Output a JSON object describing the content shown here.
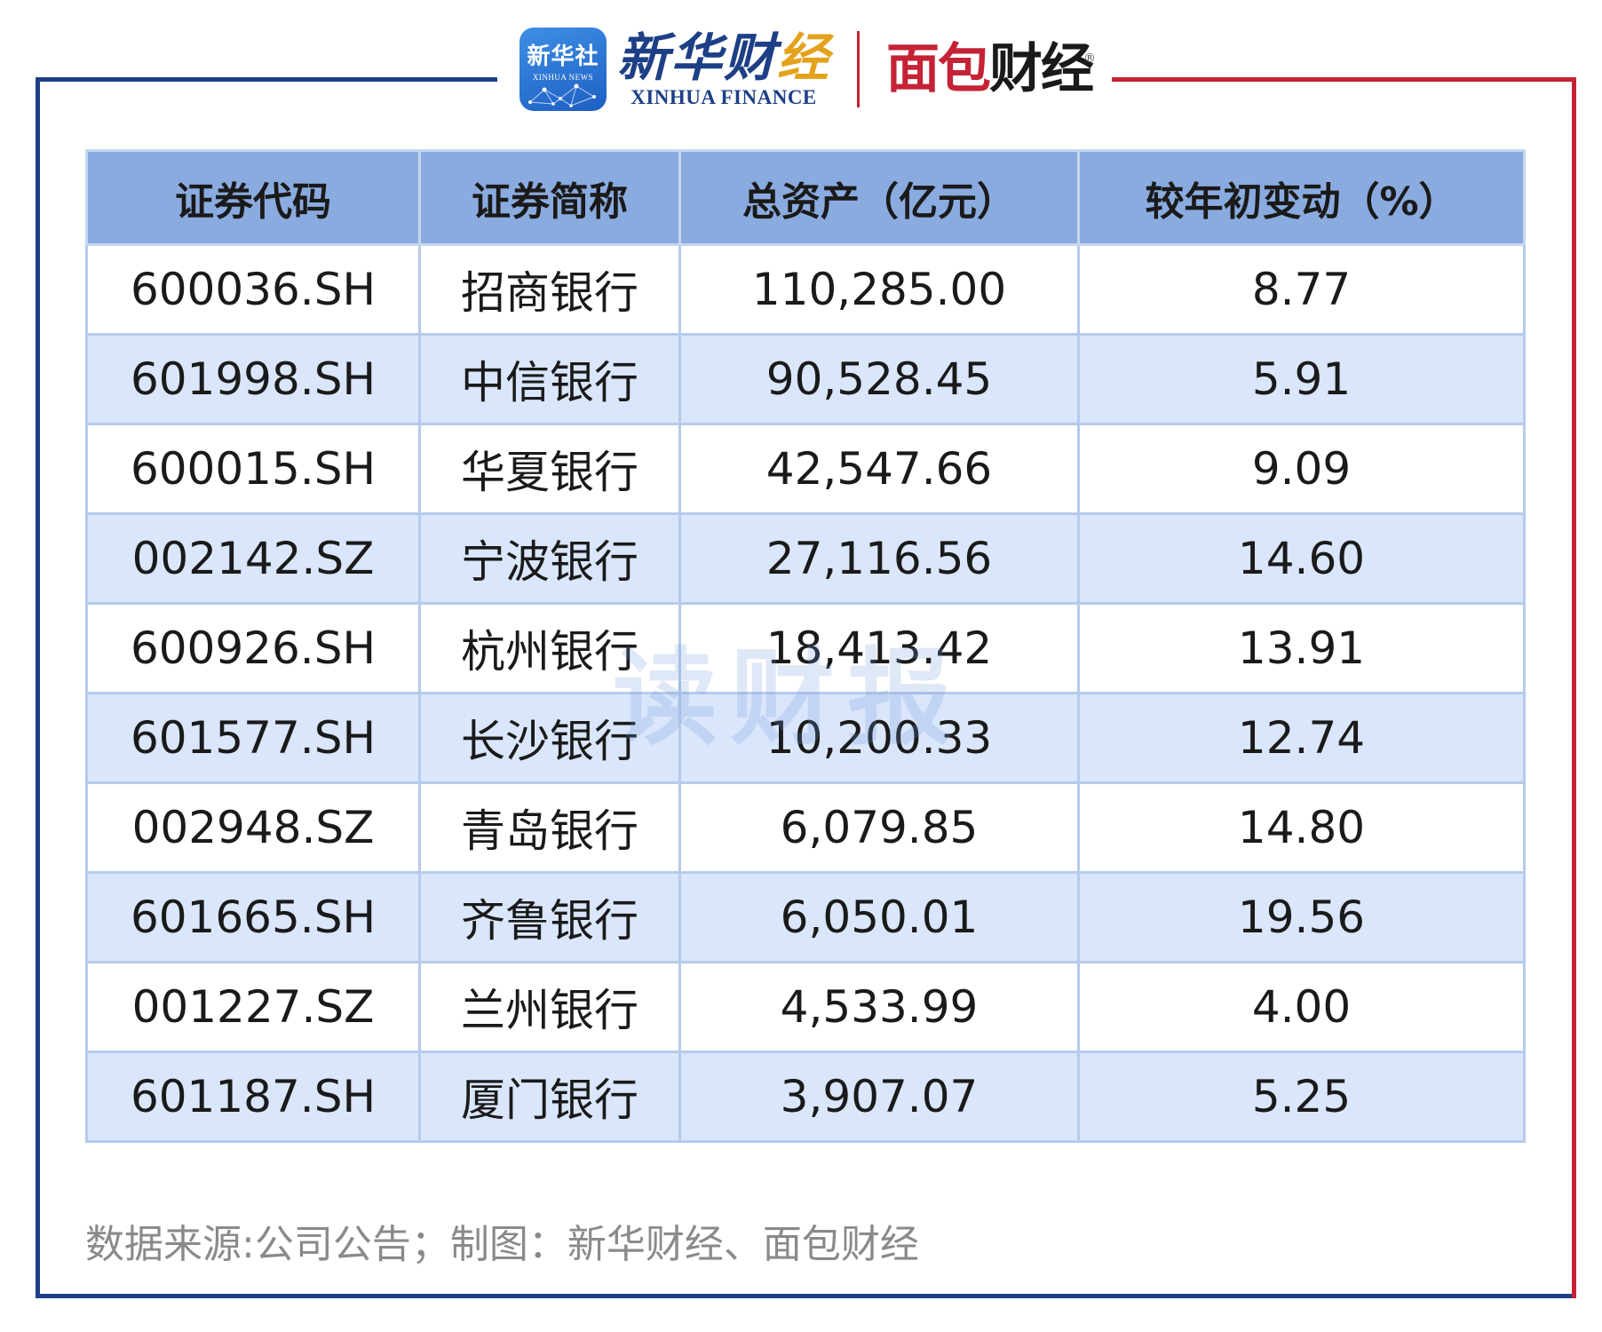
{
  "logos": {
    "xinhua_badge_cn": "新华社",
    "xinhua_badge_en": "XINHUA NEWS",
    "xinhua_finance_cn_a": "新华财",
    "xinhua_finance_cn_b": "经",
    "xinhua_finance_en": "XINHUA FINANCE",
    "mianbao_red": "面包",
    "mianbao_dark": "财经",
    "registered_mark": "®"
  },
  "colors": {
    "frame_blue": "#1d3f86",
    "frame_red": "#c52236",
    "header_bg": "#8aabdf",
    "row_alt_bg": "#d9e6fb"
  },
  "table": {
    "headers": [
      "证券代码",
      "证券简称",
      "总资产（亿元）",
      "较年初变动（%）"
    ],
    "rows": [
      [
        "600036.SH",
        "招商银行",
        "110,285.00",
        "8.77"
      ],
      [
        "601998.SH",
        "中信银行",
        "90,528.45",
        "5.91"
      ],
      [
        "600015.SH",
        "华夏银行",
        "42,547.66",
        "9.09"
      ],
      [
        "002142.SZ",
        "宁波银行",
        "27,116.56",
        "14.60"
      ],
      [
        "600926.SH",
        "杭州银行",
        "18,413.42",
        "13.91"
      ],
      [
        "601577.SH",
        "长沙银行",
        "10,200.33",
        "12.74"
      ],
      [
        "002948.SZ",
        "青岛银行",
        "6,079.85",
        "14.80"
      ],
      [
        "601665.SH",
        "齐鲁银行",
        "6,050.01",
        "19.56"
      ],
      [
        "001227.SZ",
        "兰州银行",
        "4,533.99",
        "4.00"
      ],
      [
        "601187.SH",
        "厦门银行",
        "3,907.07",
        "5.25"
      ]
    ]
  },
  "watermark": "读财报",
  "source": "数据来源:公司公告；制图：新华财经、面包财经"
}
